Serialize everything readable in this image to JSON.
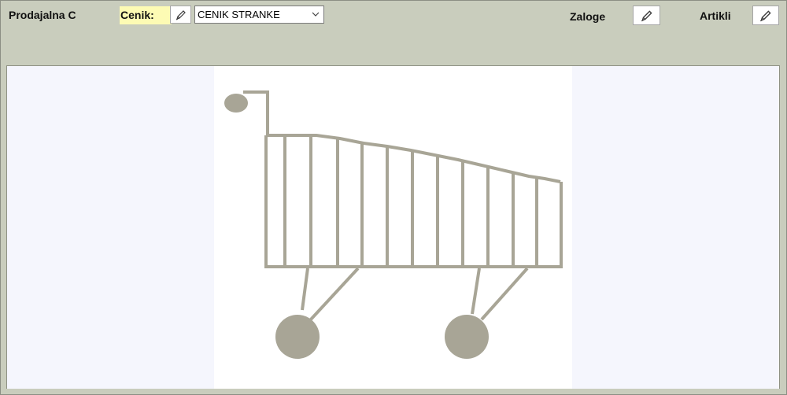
{
  "header": {
    "shop_label": "Prodajalna C",
    "price_list_label": "Cenik:",
    "price_list_selected": "CENIK STRANKE",
    "deposits_label": "Zaloge",
    "articles_label": "Artikli"
  },
  "icons": {
    "price_list_edit": "pencil-icon",
    "deposits_edit": "pencil-icon",
    "articles_edit": "pencil-icon",
    "dropdown": "chevron-down-icon",
    "cart": "shopping-cart-icon"
  },
  "colors": {
    "background": "#c9cdbd",
    "panel": "#f5f6fd",
    "label_highlight": "#fdfbb4",
    "cart": "#a8a596"
  }
}
